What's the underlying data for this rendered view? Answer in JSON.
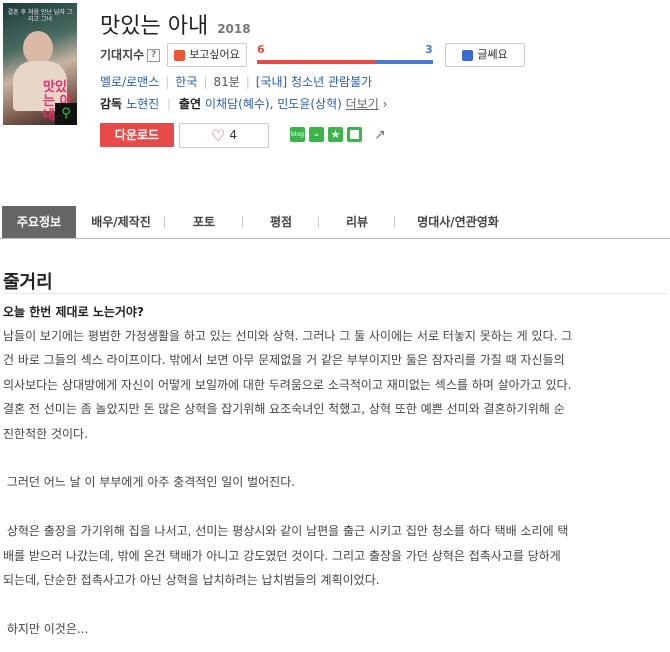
{
  "movie": {
    "title": "맛있는 아내",
    "year": "2018",
    "poster": {
      "caption": "결혼 후 처음 만난 남자 그리고 그녀",
      "logo": "맛있는 아내",
      "zoom_icon": "search-icon"
    }
  },
  "expectation": {
    "label": "기대지수",
    "help_icon": "?",
    "like_label": "보고싶어요",
    "dislike_label": "글쎄요",
    "like_count": "6",
    "dislike_count": "3",
    "like_ratio": 0.67,
    "like_color": "#e84a4a",
    "dislike_color": "#4a7bd4"
  },
  "meta": {
    "genre": "멜로/로맨스",
    "country": "한국",
    "runtime": "81분",
    "rating": "[국내] 청소년 관람불가"
  },
  "crew": {
    "director_label": "감독",
    "director": "노현진",
    "cast_label": "출연",
    "cast_1": "이채담(혜수)",
    "cast_2": "민도윤(상혁)",
    "more": "더보기"
  },
  "actions": {
    "download": "다운로드",
    "heart_count": "4",
    "download_color": "#e84a4a"
  },
  "share": {
    "blog": "blog",
    "cafe": "cafe",
    "star": "★",
    "share_icon": "share-icon"
  },
  "tabs": [
    "주요정보",
    "배우/제작진",
    "포토",
    "평점",
    "리뷰",
    "명대사/연관영화"
  ],
  "synopsis": {
    "heading": "줄거리",
    "subtitle": "오늘 한번 제대로 노는거야?",
    "lines": [
      "남들이 보기에는 평범한 가정생활을 하고 있는 선미와 상혁. 그러나 그 둘 사이에는 서로 터놓지 못하는 게 있다. 그",
      "건 바로 그들의 섹스 라이프이다. 밖에서 보면 아무 문제없을 거 같은 부부이지만 둘은 잠자리를 가질 때 자신들의",
      "의사보다는 상대방에게 자신이 어떻게 보일까에 대한 두려움으로 소극적이고 재미없는 섹스를 하며 살아가고 있다.",
      "결혼 전 선미는 좀 놀았지만 돈 많은 상혁을 잡기위해 요조숙녀인 척했고, 상혁 또한 예쁜 선미와 결혼하기위해 순",
      "진한척한 것이다.",
      "",
      " 그러던 어느 날 이 부부에게 아주 충격적인 일이 벌어진다.",
      "",
      " 상혁은 출장을 가기위해 집을 나서고, 선미는 평상시와 같이 남편을 출근 시키고 집안 청소를 하다 택배 소리에 택",
      "배를 받으러 나갔는데, 밖에 온건 택배가 아니고 강도였던 것이다. 그리고 출장을 가던 상혁은 접촉사고를 당하게",
      "되는데, 단순한 접촉사고가 아닌 상혁을 납치하려는 납치범들의 계획이었다.",
      "",
      " 하지만 이것은..."
    ]
  }
}
